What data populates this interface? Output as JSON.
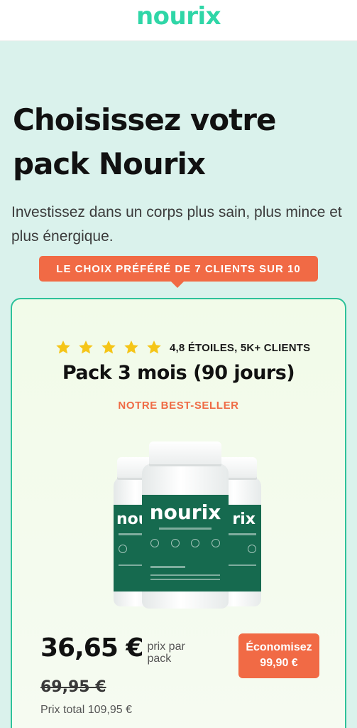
{
  "header": {
    "logo": "nourix"
  },
  "hero": {
    "title": "Choisissez votre pack Nourix",
    "subtitle": "Investissez dans un corps plus sain, plus mince et plus énergique."
  },
  "ribbon": {
    "label": "LE CHOIX PRÉFÉRÉ DE 7 CLIENTS SUR 10"
  },
  "card": {
    "rating": {
      "stars": 5,
      "text": "4,8 ÉTOILES, 5K+ CLIENTS",
      "star_color": "#f5c518"
    },
    "title": "Pack 3 mois (90 jours)",
    "tag": "NOTRE BEST-SELLER",
    "product": {
      "brand_center": "nourix",
      "brand_left": "nou",
      "brand_right": "rix"
    },
    "price": {
      "current": "36,65 €",
      "note": "prix par pack",
      "old": "69,95 €",
      "total": "Prix total 109,95 €"
    },
    "save": {
      "line1": "Économisez",
      "line2": "99,90 €"
    }
  },
  "colors": {
    "brand": "#2fd6a7",
    "accent": "#f16a45",
    "bottle_label": "#166a4f",
    "card_border": "#2ec29a"
  }
}
